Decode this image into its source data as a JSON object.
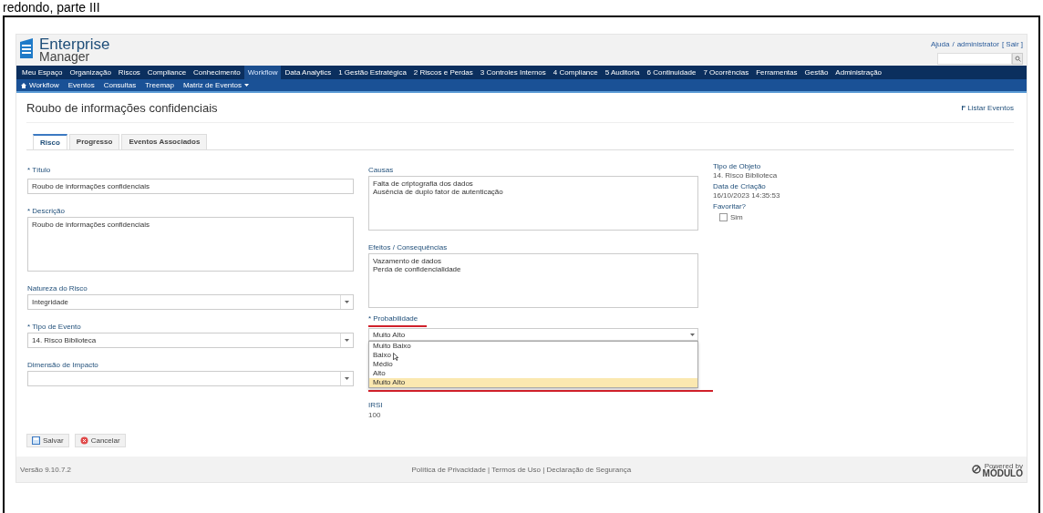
{
  "document": {
    "caption": "redondo, parte III"
  },
  "header": {
    "logo_title": "Enterprise",
    "logo_subtitle": "Manager",
    "user_links": [
      {
        "label": "Ajuda"
      },
      {
        "label": "/"
      },
      {
        "label": "administrator"
      },
      {
        "label": "[ Sair ]"
      }
    ]
  },
  "main_nav": [
    {
      "label": "Meu Espaço",
      "selected": false
    },
    {
      "label": "Organização",
      "selected": false
    },
    {
      "label": "Riscos",
      "selected": false
    },
    {
      "label": "Compliance",
      "selected": false
    },
    {
      "label": "Conhecimento",
      "selected": false
    },
    {
      "label": "Workflow",
      "selected": true
    },
    {
      "label": "Data Analytics",
      "selected": false
    },
    {
      "label": "1 Gestão Estratégica",
      "selected": false
    },
    {
      "label": "2 Riscos e Perdas",
      "selected": false
    },
    {
      "label": "3 Controles Internos",
      "selected": false
    },
    {
      "label": "4 Compliance",
      "selected": false
    },
    {
      "label": "5 Auditoria",
      "selected": false
    },
    {
      "label": "6 Continuidade",
      "selected": false
    },
    {
      "label": "7 Ocorrências",
      "selected": false
    },
    {
      "label": "Ferramentas",
      "selected": false
    },
    {
      "label": "Gestão",
      "selected": false
    },
    {
      "label": "Administração",
      "selected": false
    }
  ],
  "sub_nav": [
    {
      "label": "Workflow",
      "kind": "home"
    },
    {
      "label": "Eventos",
      "kind": "plain"
    },
    {
      "label": "Consultas",
      "kind": "plain"
    },
    {
      "label": "Treemap",
      "kind": "plain"
    },
    {
      "label": "Matriz de Eventos",
      "kind": "menu"
    }
  ],
  "page": {
    "title": "Roubo de informações confidenciais",
    "back_link": "Listar Eventos"
  },
  "tabs": [
    {
      "label": "Risco",
      "selected": true
    },
    {
      "label": "Progresso",
      "selected": false
    },
    {
      "label": "Eventos Associados",
      "selected": false
    }
  ],
  "left_fields": [
    {
      "kind": "input",
      "label": "* Título",
      "value": "Roubo de informações confidenciais"
    },
    {
      "kind": "textarea",
      "label": "* Descrição",
      "value": "Roubo de informações confidenciais"
    },
    {
      "kind": "select",
      "label": "Natureza do Risco",
      "value": "Integridade"
    },
    {
      "kind": "select",
      "label": "* Tipo de Evento",
      "value": "14. Risco Biblioteca"
    },
    {
      "kind": "select",
      "label": "Dimensão de Impacto"
    }
  ],
  "middle_fields": [
    {
      "kind": "textarea",
      "label": "Causas",
      "value": "Falta de criptografia dos dados\nAusência de duplo fator de autenticação"
    },
    {
      "kind": "textarea",
      "label": "Efeitos / Consequências",
      "value": "Vazamento de dados\nPerda de confidencialidade"
    }
  ],
  "probability": {
    "label": "* Probabilidade",
    "value": "Muito Alto",
    "options": [
      {
        "label": "Muito Baixo",
        "selected": false
      },
      {
        "label": "Baixo",
        "selected": false
      },
      {
        "label": "Médio",
        "selected": false
      },
      {
        "label": "Alto",
        "selected": false
      },
      {
        "label": "Muito Alto",
        "selected": true
      }
    ]
  },
  "score": {
    "label": "IRSI",
    "value": "100"
  },
  "info": [
    {
      "label": "Tipo de Objeto",
      "value": "14. Risco Biblioteca"
    },
    {
      "label": "Data de Criação",
      "value": "16/10/2023 14:35:53"
    }
  ],
  "favorite": {
    "label": "Favoritar?",
    "option": "Sim",
    "checked": false
  },
  "buttons": [
    {
      "label": "Salvar",
      "kind": "save"
    },
    {
      "label": "Cancelar",
      "kind": "cancel"
    }
  ],
  "footer": {
    "version": "Versão 9.10.7.2",
    "links": "Política de Privacidade | Termos de Uso | Declaração de Segurança",
    "powered_by": "Powered by",
    "brand": "MÓDULO"
  }
}
